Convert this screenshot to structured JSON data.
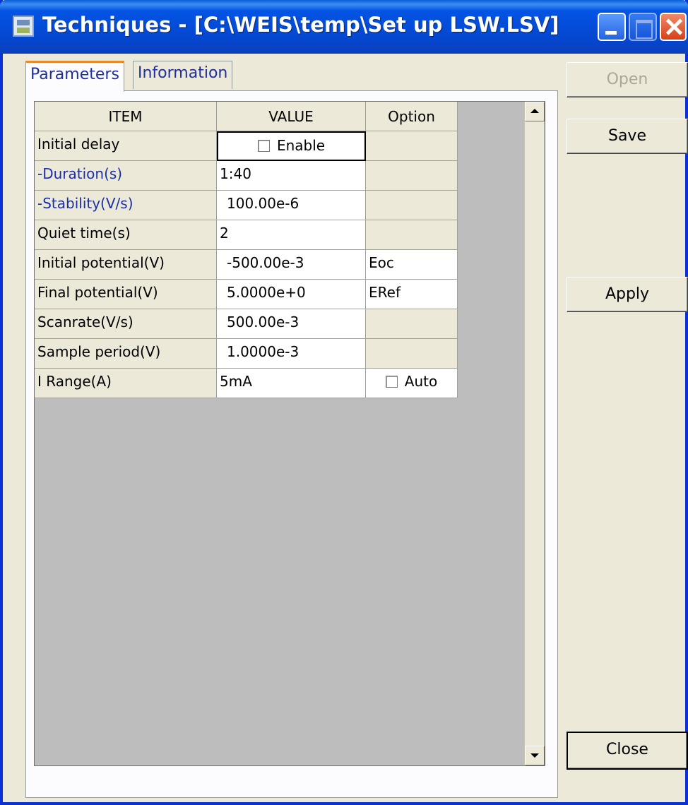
{
  "window": {
    "title": "Techniques - [C:\\WEIS\\temp\\Set up LSW.LSV]"
  },
  "tabs": [
    {
      "label": "Parameters"
    },
    {
      "label": "Information"
    }
  ],
  "grid": {
    "headers": {
      "item": "ITEM",
      "value": "VALUE",
      "option": "Option"
    },
    "rows": [
      {
        "item": "Initial delay",
        "value": "Enable",
        "option": ""
      },
      {
        "item": "-Duration(s)",
        "value": "1:40",
        "option": ""
      },
      {
        "item": "-Stability(V/s)",
        "value": "100.00e-6",
        "option": ""
      },
      {
        "item": "Quiet time(s)",
        "value": "2",
        "option": ""
      },
      {
        "item": "Initial potential(V)",
        "value": "-500.00e-3",
        "option": "Eoc"
      },
      {
        "item": "Final potential(V)",
        "value": "5.0000e+0",
        "option": "ERef"
      },
      {
        "item": "Scanrate(V/s)",
        "value": "500.00e-3",
        "option": ""
      },
      {
        "item": "Sample period(V)",
        "value": "1.0000e-3",
        "option": ""
      },
      {
        "item": "I Range(A)",
        "value": "5mA",
        "option": "Auto"
      }
    ]
  },
  "buttons": {
    "open": "Open",
    "save": "Save",
    "apply": "Apply",
    "close": "Close"
  }
}
